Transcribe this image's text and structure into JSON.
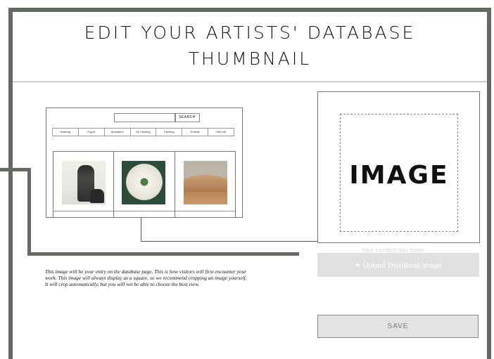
{
  "header": {
    "title_line1": "EDIT YOUR ARTISTS' DATABASE",
    "title_line2": "THUMBNAIL"
  },
  "mockup": {
    "search_button": "SEARCH",
    "filters": [
      "Drawing",
      "Figure",
      "Illustration",
      "Oil Painting",
      "Painting",
      "Portrait",
      "Still Life"
    ],
    "artworks": [
      "figure-painting",
      "white-flower-painting",
      "desert-hills-painting"
    ]
  },
  "preview": {
    "image_label": "IMAGE",
    "ghost_text": "Your content has been"
  },
  "upload": {
    "plus_icon": "+",
    "label": "Upload Thumbnail Image"
  },
  "description": "This image will be your entry on the database page. This is how visitors will first encounter your work. This image will always display as a square, so we recommend cropping an image yourself. It will crop automatically, but you will not be able to choose the best view.",
  "save": {
    "label": "SAVE"
  },
  "colors": {
    "frame": "#626a62",
    "button_bg": "#e0e0e0"
  }
}
